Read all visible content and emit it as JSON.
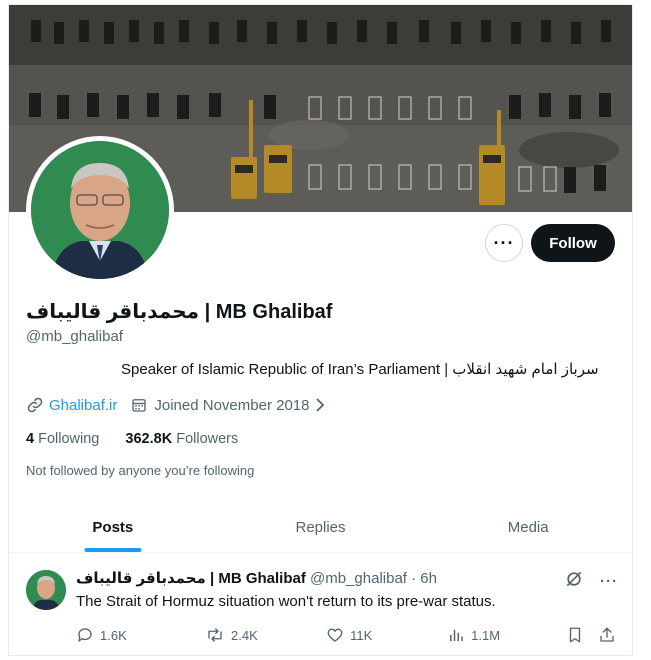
{
  "profile": {
    "name": "محمدباقر قالیباف | MB Ghalibaf",
    "handle": "@mb_ghalibaf",
    "bio": "Speaker of Islamic Republic of Iran’s Parliament | سرباز امام شهید انقلاب",
    "link": "Ghalibaf.ir",
    "joined": "Joined November 2018",
    "following_count": "4",
    "following_label": "Following",
    "followers_count": "362.8K",
    "followers_label": "Followers",
    "not_followed": "Not followed by anyone you’re following"
  },
  "buttons": {
    "more": "···",
    "follow": "Follow"
  },
  "tabs": [
    {
      "label": "Posts",
      "active": true
    },
    {
      "label": "Replies",
      "active": false
    },
    {
      "label": "Media",
      "active": false
    }
  ],
  "tweet": {
    "author": "محمدباقر قالیباف | MB Ghalibaf",
    "handle_time": "@mb_ghalibaf · 6h",
    "text": "The Strait of Hormuz situation won't return to its pre-war status.",
    "replies": "1.6K",
    "reposts": "2.4K",
    "likes": "11K",
    "views": "1.1M",
    "more": "···"
  },
  "icons": {
    "link": "link-icon",
    "calendar": "calendar-icon",
    "chevron": "chevron-right-icon",
    "reply": "reply-icon",
    "repost": "repost-icon",
    "like": "like-icon",
    "views": "views-icon",
    "bookmark": "bookmark-icon",
    "share": "share-icon",
    "grok": "grok-icon"
  },
  "colors": {
    "accent": "#1d9bf0",
    "text": "#0f1419",
    "muted": "#536471",
    "follow_bg": "#0f1419"
  }
}
